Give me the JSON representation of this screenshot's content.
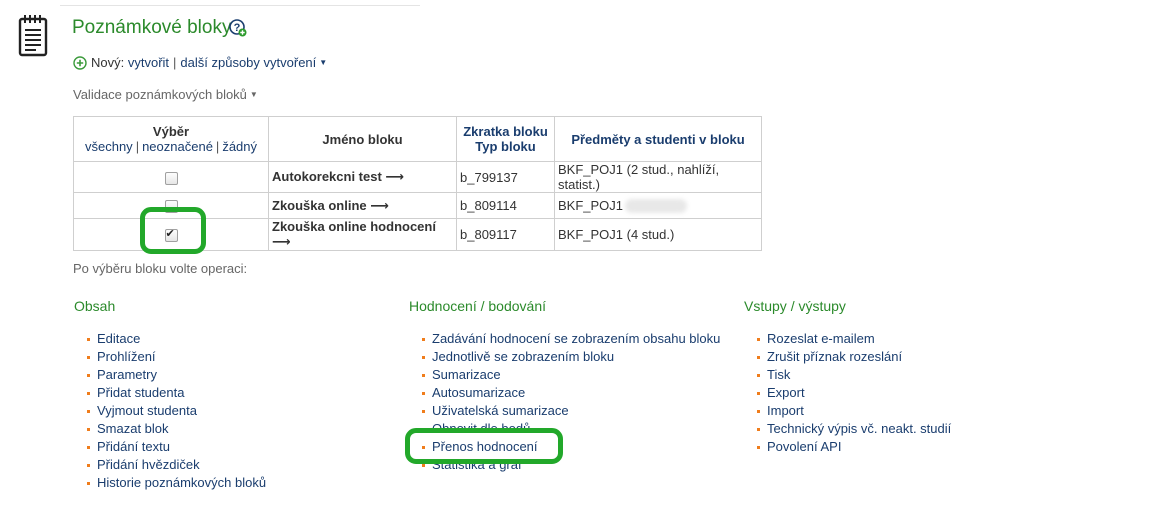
{
  "header": {
    "title": "Poznámkové bloky",
    "help_icon": "help-plus-icon",
    "page_icon": "notepad-icon"
  },
  "create": {
    "prefix": "Nový:",
    "create_link": "vytvořit",
    "separator": "|",
    "other_ways": "další způsoby vytvoření"
  },
  "validation_link": "Validace poznámkových bloků",
  "table": {
    "headers": {
      "select": "Výběr",
      "select_all": "všechny",
      "select_marked": "neoznačené",
      "select_none": "žádný",
      "name": "Jméno bloku",
      "abbr": "Zkratka bloku",
      "type": "Typ bloku",
      "subjects": "Předměty a studenti v bloku"
    },
    "rows": [
      {
        "checked": false,
        "name": "Autokorekcni test ⟶",
        "abbr": "b_799137",
        "subjects": "BKF_POJ1 (2 stud., nahlíží, statist.)"
      },
      {
        "checked": false,
        "name": "Zkouška online ⟶",
        "abbr": "b_809114",
        "subjects": "BKF_POJ1"
      },
      {
        "checked": true,
        "name": "Zkouška online hodnocení ⟶",
        "abbr": "b_809117",
        "subjects": "BKF_POJ1 (4 stud.)"
      }
    ]
  },
  "operations_prompt": "Po výběru bloku volte operaci:",
  "columns": {
    "obsah": {
      "title": "Obsah",
      "items": [
        "Editace",
        "Prohlížení",
        "Parametry",
        "Přidat studenta",
        "Vyjmout studenta",
        "Smazat blok",
        "Přidání textu",
        "Přidání hvězdiček",
        "Historie poznámkových bloků"
      ]
    },
    "hodnoceni": {
      "title": "Hodnocení / bodování",
      "items": [
        "Zadávání hodnocení se zobrazením obsahu bloku",
        "Jednotlivě se zobrazením bloku",
        "Sumarizace",
        "Autosumarizace",
        "Uživatelská sumarizace",
        "Obnovit dle bodů",
        "Přenos hodnocení",
        "Statistika a graf"
      ]
    },
    "vstupy": {
      "title": "Vstupy / výstupy",
      "items": [
        "Rozeslat e-mailem",
        "Zrušit příznak rozeslání",
        "Tisk",
        "Export",
        "Import",
        "Technický výpis vč. neakt. studií",
        "Povolení API"
      ]
    }
  },
  "colors": {
    "title_green": "#2b8a2b",
    "link_blue": "#1a3d6e",
    "bullet_orange": "#f07d1c",
    "highlight_green": "#22a82a"
  }
}
